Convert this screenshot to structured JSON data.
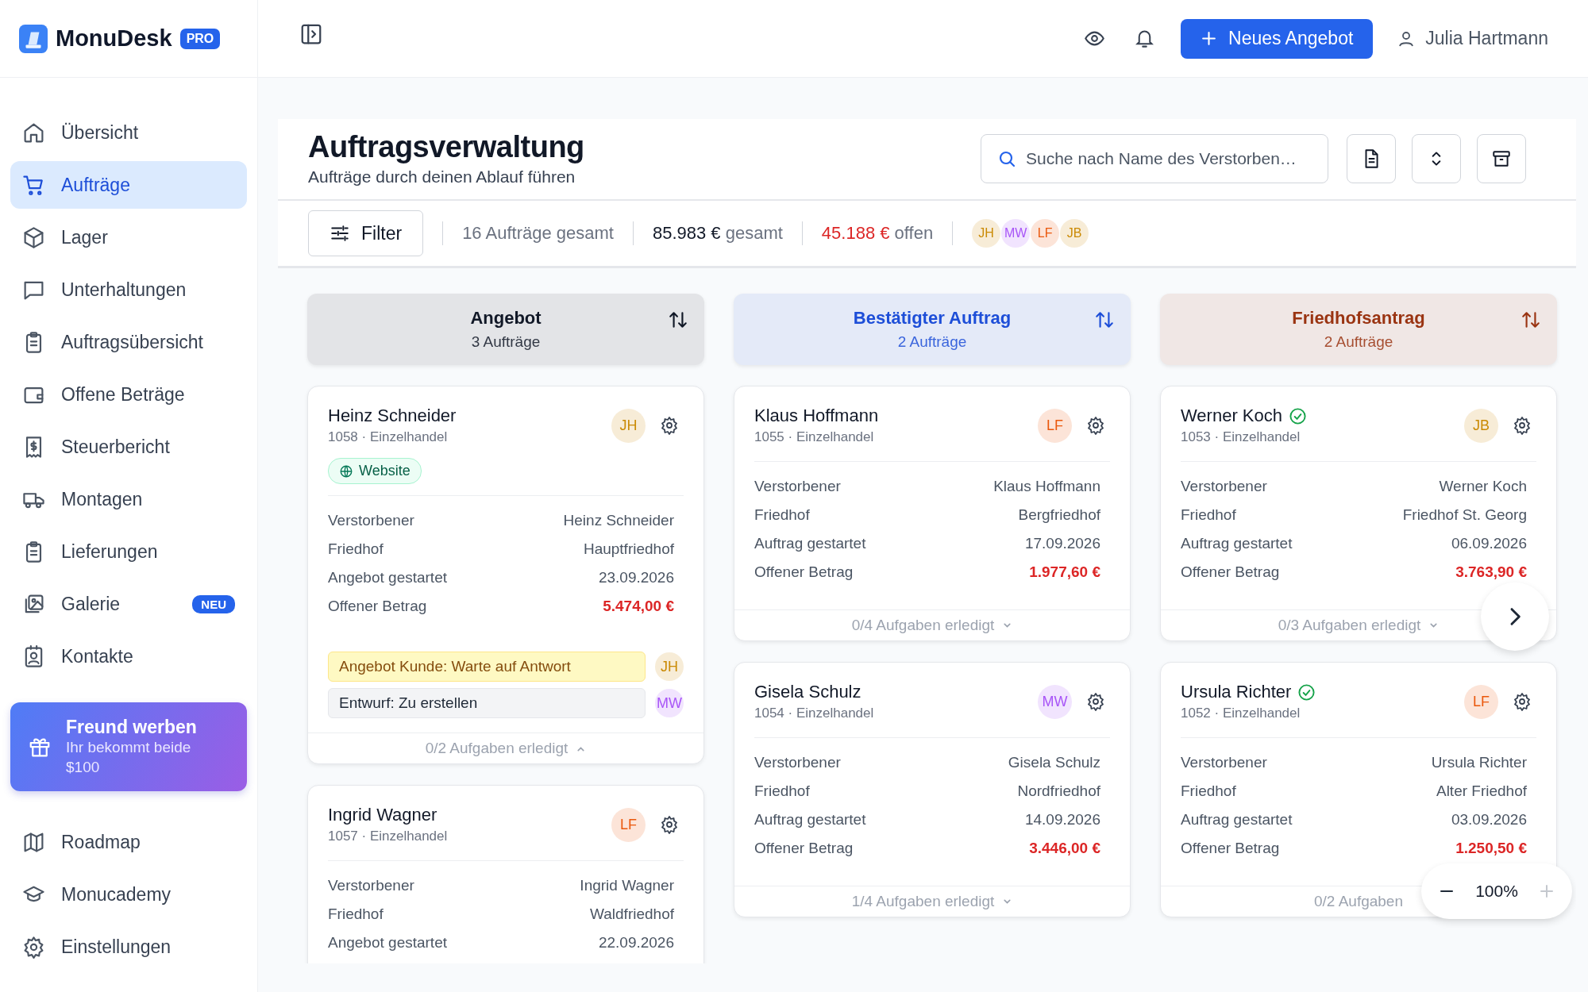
{
  "brand": {
    "name": "MonuDesk",
    "badge": "PRO"
  },
  "sidebar": {
    "items": [
      {
        "label": "Übersicht",
        "selected": false
      },
      {
        "label": "Aufträge",
        "selected": true
      },
      {
        "label": "Lager",
        "selected": false
      },
      {
        "label": "Unterhaltungen",
        "selected": false
      },
      {
        "label": "Auftragsübersicht",
        "selected": false
      },
      {
        "label": "Offene Beträge",
        "selected": false
      },
      {
        "label": "Steuerbericht",
        "selected": false
      },
      {
        "label": "Montagen",
        "selected": false
      },
      {
        "label": "Lieferungen",
        "selected": false
      },
      {
        "label": "Galerie",
        "selected": false,
        "badge": "NEU"
      },
      {
        "label": "Kontakte",
        "selected": false
      }
    ],
    "promo": {
      "title": "Freund werben",
      "text": "Ihr bekommt beide $100"
    },
    "bottom_items": [
      {
        "label": "Roadmap",
        "selected": false
      },
      {
        "label": "Monucademy",
        "selected": false
      },
      {
        "label": "Einstellungen",
        "selected": false
      }
    ]
  },
  "topbar": {
    "primary_button": "Neues Angebot",
    "user": "Julia Hartmann"
  },
  "header": {
    "title": "Auftragsverwaltung",
    "subtitle": "Aufträge durch deinen Ablauf führen",
    "search": {
      "placeholder": "Suche nach Name des Verstorben…"
    }
  },
  "filter_bar": {
    "filter_button": "Filter",
    "total_count": "16 Aufträge gesamt",
    "total_amount": "85.983 €",
    "total_label": "gesamt",
    "open_amount": "45.188 €",
    "open_label": "offen",
    "avatars": [
      {
        "initials": "JH",
        "color": "#ca8a04"
      },
      {
        "initials": "MW",
        "color": "#a855f7"
      },
      {
        "initials": "LF",
        "color": "#ea580c"
      },
      {
        "initials": "JB",
        "color": "#ca8a04"
      }
    ]
  },
  "columns": [
    {
      "title": "Angebot",
      "count": "3 Aufträge",
      "color": "#111827",
      "cards": [
        {
          "name": "Heinz Schneider",
          "verified": false,
          "meta": "1058 · Einzelhandel",
          "assignee": {
            "initials": "JH",
            "color": "#ca8a04"
          },
          "source": "Website",
          "rows": [
            {
              "label": "Verstorbener",
              "value": "Heinz Schneider",
              "kind": "text"
            },
            {
              "label": "Friedhof",
              "value": "Hauptfriedhof",
              "kind": "text"
            },
            {
              "label": "Angebot gestartet",
              "value": "23.09.2026",
              "kind": "text"
            },
            {
              "label": "Offener Betrag",
              "value": "5.474,00 €",
              "kind": "amount"
            }
          ],
          "tasks": [
            {
              "text": "Angebot Kunde: Warte auf Antwort",
              "kind": "waiting",
              "assignee": {
                "initials": "JH",
                "color": "#ca8a04"
              }
            },
            {
              "text": "Entwurf: Zu erstellen",
              "kind": "todo",
              "assignee": {
                "initials": "MW",
                "color": "#a855f7"
              }
            }
          ],
          "footer": "0/2 Aufgaben erledigt",
          "expanded": true
        },
        {
          "name": "Ingrid Wagner",
          "verified": false,
          "meta": "1057 · Einzelhandel",
          "assignee": {
            "initials": "LF",
            "color": "#ea580c"
          },
          "rows": [
            {
              "label": "Verstorbener",
              "value": "Ingrid Wagner",
              "kind": "text"
            },
            {
              "label": "Friedhof",
              "value": "Waldfriedhof",
              "kind": "text"
            },
            {
              "label": "Angebot gestartet",
              "value": "22.09.2026",
              "kind": "text"
            }
          ]
        }
      ]
    },
    {
      "title": "Bestätigter Auftrag",
      "count": "2 Aufträge",
      "color": "#1d4ed8",
      "cards": [
        {
          "name": "Klaus Hoffmann",
          "verified": false,
          "meta": "1055 · Einzelhandel",
          "assignee": {
            "initials": "LF",
            "color": "#ea580c"
          },
          "rows": [
            {
              "label": "Verstorbener",
              "value": "Klaus Hoffmann",
              "kind": "text"
            },
            {
              "label": "Friedhof",
              "value": "Bergfriedhof",
              "kind": "text"
            },
            {
              "label": "Auftrag gestartet",
              "value": "17.09.2026",
              "kind": "text"
            },
            {
              "label": "Offener Betrag",
              "value": "1.977,60 €",
              "kind": "amount"
            }
          ],
          "footer": "0/4 Aufgaben erledigt",
          "expanded": false
        },
        {
          "name": "Gisela Schulz",
          "verified": false,
          "meta": "1054 · Einzelhandel",
          "assignee": {
            "initials": "MW",
            "color": "#a855f7"
          },
          "rows": [
            {
              "label": "Verstorbener",
              "value": "Gisela Schulz",
              "kind": "text"
            },
            {
              "label": "Friedhof",
              "value": "Nordfriedhof",
              "kind": "text"
            },
            {
              "label": "Auftrag gestartet",
              "value": "14.09.2026",
              "kind": "text"
            },
            {
              "label": "Offener Betrag",
              "value": "3.446,00 €",
              "kind": "amount"
            }
          ],
          "footer": "1/4 Aufgaben erledigt",
          "expanded": false
        }
      ]
    },
    {
      "title": "Friedhofsantrag",
      "count": "2 Aufträge",
      "color": "#9a3412",
      "cards": [
        {
          "name": "Werner Koch",
          "verified": true,
          "meta": "1053 · Einzelhandel",
          "assignee": {
            "initials": "JB",
            "color": "#ca8a04"
          },
          "rows": [
            {
              "label": "Verstorbener",
              "value": "Werner Koch",
              "kind": "text"
            },
            {
              "label": "Friedhof",
              "value": "Friedhof St. Georg",
              "kind": "text"
            },
            {
              "label": "Auftrag gestartet",
              "value": "06.09.2026",
              "kind": "text"
            },
            {
              "label": "Offener Betrag",
              "value": "3.763,90 €",
              "kind": "amount"
            }
          ],
          "footer": "0/3 Aufgaben erledigt",
          "expanded": false
        },
        {
          "name": "Ursula Richter",
          "verified": true,
          "meta": "1052 · Einzelhandel",
          "assignee": {
            "initials": "LF",
            "color": "#ea580c"
          },
          "rows": [
            {
              "label": "Verstorbener",
              "value": "Ursula Richter",
              "kind": "text"
            },
            {
              "label": "Friedhof",
              "value": "Alter Friedhof",
              "kind": "text"
            },
            {
              "label": "Auftrag gestartet",
              "value": "03.09.2026",
              "kind": "text"
            },
            {
              "label": "Offener Betrag",
              "value": "1.250,50 €",
              "kind": "amount"
            }
          ],
          "footer": "0/2 Aufgaben"
        }
      ]
    }
  ],
  "zoom_control": {
    "value": "100%"
  }
}
